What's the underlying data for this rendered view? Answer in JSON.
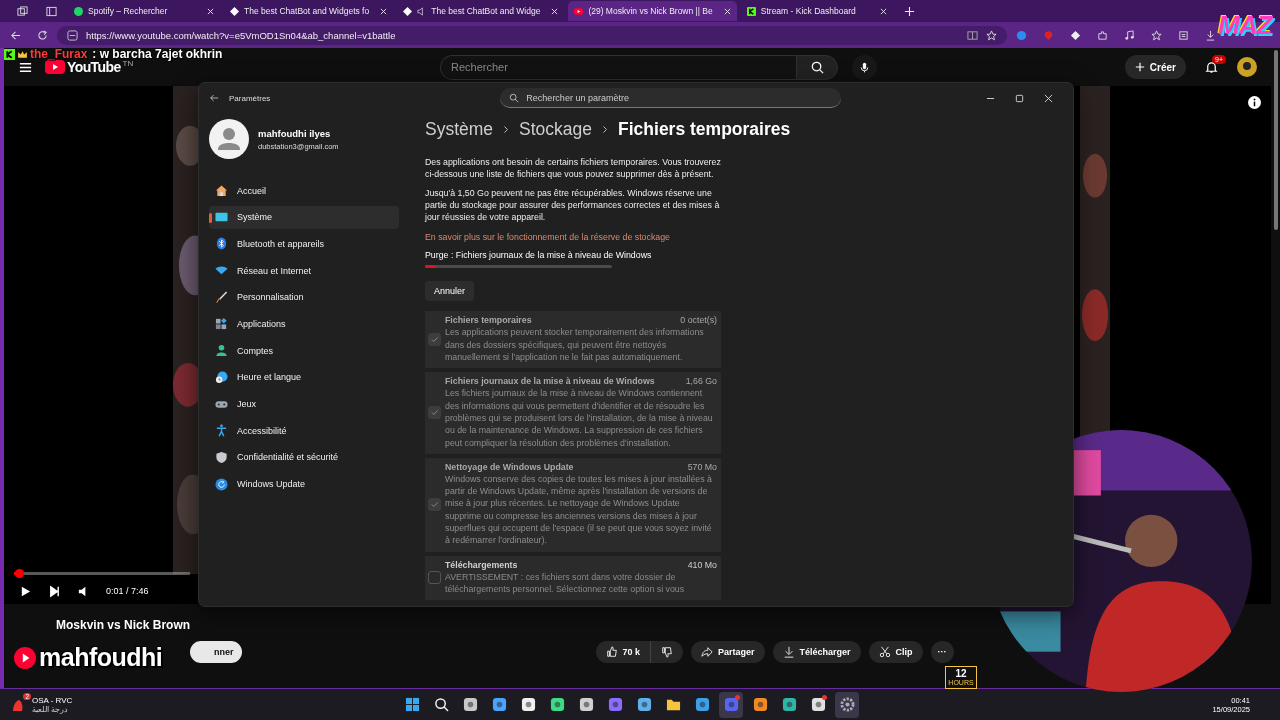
{
  "browser": {
    "tabs": [
      {
        "kind": "spotify",
        "label": "Spotify – Rechercher",
        "audio": false,
        "selected": false
      },
      {
        "kind": "chatbot",
        "label": "The best ChatBot and Widgets fo",
        "audio": false,
        "selected": false
      },
      {
        "kind": "chatbot",
        "label": "The best ChatBot and Widge",
        "audio": true,
        "selected": false
      },
      {
        "kind": "youtube",
        "label": "(29) Moskvin vs Nick Brown || Be",
        "audio": false,
        "selected": true
      },
      {
        "kind": "kick",
        "label": "Stream - Kick Dashboard",
        "audio": false,
        "selected": false
      }
    ],
    "url": "https://www.youtube.com/watch?v=e5VmOD1Sn04&ab_channel=v1battle"
  },
  "stream_overlay": {
    "logo": "MAZ",
    "chat_user": "the_Furax",
    "chat_message": ": w barcha 7ajet okhrin",
    "name": "mahfoudhi",
    "sticker_number": "12",
    "sticker_label": "HOURS"
  },
  "youtube": {
    "logo": "YouTube",
    "region": "TN",
    "search": {
      "placeholder": "Rechercher"
    },
    "create": "Créer",
    "notifications": "9+",
    "player": {
      "time": "0:01 / 7:46",
      "progress": {
        "level": 0.03
      }
    },
    "title": "Moskvin vs Nick Brown",
    "subscribe": "nner",
    "actions": [
      {
        "kind": "like",
        "label": "70 k"
      },
      {
        "kind": "dislike"
      },
      {
        "kind": "share",
        "label": "Partager"
      },
      {
        "kind": "download",
        "label": "Télécharger"
      },
      {
        "kind": "clip",
        "label": "Clip"
      },
      {
        "kind": "more",
        "label": "···"
      }
    ]
  },
  "settings": {
    "title": "Paramètres",
    "search": {
      "placeholder": "Rechercher un paramètre"
    },
    "user": {
      "name": "mahfoudhi ilyes",
      "email": "dubstation3@gmail.com"
    },
    "nav": [
      {
        "kind": "home",
        "label": "Accueil",
        "selected": false
      },
      {
        "kind": "system",
        "label": "Système",
        "selected": true
      },
      {
        "kind": "bluetooth",
        "label": "Bluetooth et appareils",
        "selected": false
      },
      {
        "kind": "network",
        "label": "Réseau et Internet",
        "selected": false
      },
      {
        "kind": "personalization",
        "label": "Personnalisation",
        "selected": false
      },
      {
        "kind": "apps",
        "label": "Applications",
        "selected": false
      },
      {
        "kind": "accounts",
        "label": "Comptes",
        "selected": false
      },
      {
        "kind": "time",
        "label": "Heure et langue",
        "selected": false
      },
      {
        "kind": "gaming",
        "label": "Jeux",
        "selected": false
      },
      {
        "kind": "accessibility",
        "label": "Accessibilité",
        "selected": false
      },
      {
        "kind": "privacy",
        "label": "Confidentialité et sécurité",
        "selected": false
      },
      {
        "kind": "update",
        "label": "Windows Update",
        "selected": false
      }
    ],
    "breadcrumb": [
      "Système",
      "Stockage",
      "Fichiers temporaires"
    ],
    "paragraphs": [
      "Des applications ont besoin de certains fichiers temporaires. Vous trouverez ci-dessous une liste de fichiers que vous pouvez supprimer dès à présent.",
      "Jusqu'à 1,50 Go peuvent ne pas être récupérables. Windows réserve une partie du stockage pour assurer des performances correctes et des mises à jour réussies de votre appareil."
    ],
    "link": "En savoir plus sur le fonctionnement de la réserve de stockage",
    "progress": {
      "label": "Purge : Fichiers journaux de la mise à niveau de Windows",
      "level": 0.06
    },
    "cancel": "Annuler",
    "items": [
      {
        "title": "Fichiers temporaires",
        "size": "0 octet(s)",
        "checked": true,
        "disabled": true,
        "description": "Les applications peuvent stocker temporairement des informations dans des dossiers spécifiques, qui peuvent être nettoyés manuellement si l'application ne le fait pas automatiquement."
      },
      {
        "title": "Fichiers journaux de la mise à niveau de Windows",
        "size": "1,66 Go",
        "checked": true,
        "disabled": true,
        "description": "Les fichiers journaux de la mise à niveau de Windows contiennent des informations qui vous permettent d'identifier et de résoudre les problèmes qui se produisent lors de l'installation, de la mise à niveau ou de la maintenance de Windows. La suppression de ces fichiers peut compliquer la résolution des problèmes d'installation."
      },
      {
        "title": "Nettoyage de Windows Update",
        "size": "570 Mo",
        "checked": true,
        "disabled": true,
        "description": "Windows conserve des copies de toutes les mises à jour installées à partir de Windows Update, même après l'installation de versions de mise à jour plus récentes. Le nettoyage de Windows Update supprime ou compresse les anciennes versions des mises à jour superflues qui occupent de l'espace (il se peut que vous soyez invité à redémarrer l'ordinateur)."
      },
      {
        "title": "Téléchargements",
        "size": "410 Mo",
        "checked": false,
        "disabled": false,
        "description": "AVERTISSEMENT : ces fichiers sont dans votre dossier de téléchargements personnel. Sélectionnez cette option si vous"
      }
    ]
  },
  "taskbar": {
    "widget": {
      "badge": "2",
      "title": "OSA - RVC",
      "subtitle": "درجة اللعبة"
    },
    "apps": [
      {
        "kind": "start",
        "active": false,
        "notification": false
      },
      {
        "kind": "search",
        "active": false,
        "notification": false
      },
      {
        "kind": "taskview",
        "active": false,
        "notification": false
      },
      {
        "kind": "widgets",
        "active": false,
        "notification": false
      },
      {
        "kind": "capcut",
        "active": false,
        "notification": false
      },
      {
        "kind": "android",
        "active": false,
        "notification": false
      },
      {
        "kind": "obs",
        "active": false,
        "notification": false
      },
      {
        "kind": "copilot",
        "active": false,
        "notification": false
      },
      {
        "kind": "window",
        "active": false,
        "notification": false
      },
      {
        "kind": "folder",
        "active": false,
        "notification": false
      },
      {
        "kind": "vscode",
        "active": false,
        "notification": false
      },
      {
        "kind": "discord",
        "active": true,
        "notification": true
      },
      {
        "kind": "fl",
        "active": false,
        "notification": false
      },
      {
        "kind": "edge",
        "active": false,
        "notification": false
      },
      {
        "kind": "chrome",
        "active": false,
        "notification": true
      },
      {
        "kind": "settings",
        "active": true,
        "notification": false
      }
    ],
    "time": "00:41",
    "date": "15/09/2025"
  }
}
